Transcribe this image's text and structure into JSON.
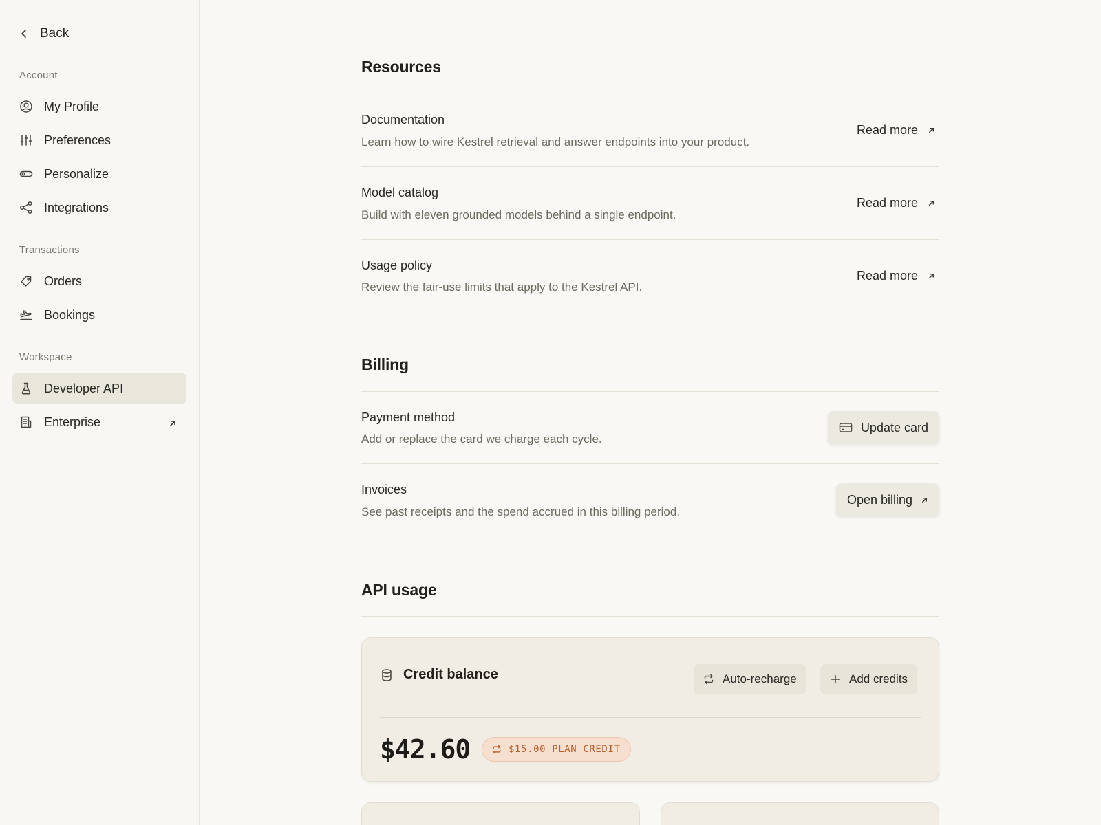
{
  "sidebar": {
    "back_label": "Back",
    "groups": [
      {
        "label": "Account",
        "items": [
          {
            "label": "My Profile",
            "icon": "user-circle-icon"
          },
          {
            "label": "Preferences",
            "icon": "sliders-icon"
          },
          {
            "label": "Personalize",
            "icon": "toggle-icon"
          },
          {
            "label": "Integrations",
            "icon": "share-nodes-icon"
          }
        ]
      },
      {
        "label": "Transactions",
        "items": [
          {
            "label": "Orders",
            "icon": "tag-icon"
          },
          {
            "label": "Bookings",
            "icon": "plane-icon"
          }
        ]
      },
      {
        "label": "Workspace",
        "items": [
          {
            "label": "Developer API",
            "icon": "flask-icon",
            "active": true
          },
          {
            "label": "Enterprise",
            "icon": "building-icon",
            "external": true
          }
        ]
      }
    ]
  },
  "resources": {
    "title": "Resources",
    "rows": [
      {
        "title": "Documentation",
        "desc": "Learn how to wire Kestrel retrieval and answer endpoints into your product.",
        "action": "Read more"
      },
      {
        "title": "Model catalog",
        "desc": "Build with eleven grounded models behind a single endpoint.",
        "action": "Read more"
      },
      {
        "title": "Usage policy",
        "desc": "Review the fair-use limits that apply to the Kestrel API.",
        "action": "Read more"
      }
    ]
  },
  "billing": {
    "title": "Billing",
    "rows": [
      {
        "title": "Payment method",
        "desc": "Add or replace the card we charge each cycle.",
        "action": "Update card"
      },
      {
        "title": "Invoices",
        "desc": "See past receipts and the spend accrued in this billing period.",
        "action": "Open billing"
      }
    ]
  },
  "api_usage": {
    "title": "API usage",
    "credit": {
      "heading": "Credit balance",
      "auto_recharge_label": "Auto-recharge",
      "add_credits_label": "Add credits",
      "balance": "$42.60",
      "plan_credit": "$15.00 PLAN CREDIT"
    }
  }
}
